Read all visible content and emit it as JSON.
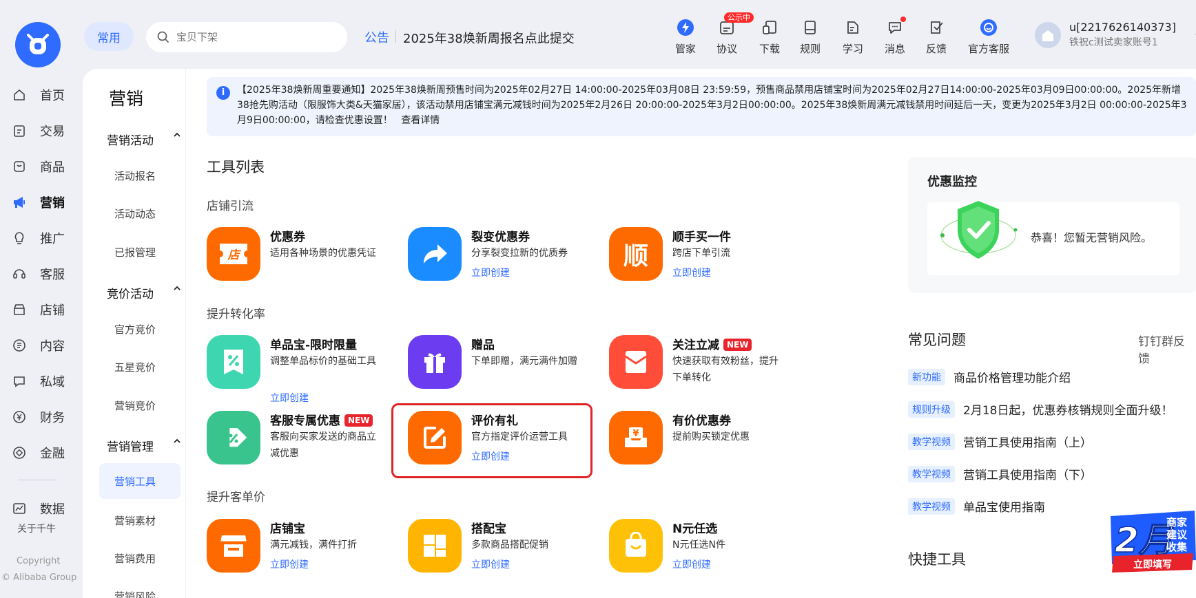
{
  "topbar": {
    "chip_label": "常用",
    "search_placeholder": "宝贝下架",
    "notice_tag": "公告",
    "notice_text": "2025年38焕新周报名点此提交",
    "tools": [
      {
        "label": "管家",
        "icon": "lightning-icon"
      },
      {
        "label": "协议",
        "icon": "agreement-icon",
        "badge": "公示中"
      },
      {
        "label": "下载",
        "icon": "download-icon"
      },
      {
        "label": "规则",
        "icon": "rules-icon"
      },
      {
        "label": "学习",
        "icon": "learn-icon"
      },
      {
        "label": "消息",
        "icon": "message-icon"
      },
      {
        "label": "反馈",
        "icon": "feedback-icon"
      },
      {
        "label": "官方客服",
        "icon": "customer-service-icon"
      }
    ],
    "user_id": "u[2217626140373]",
    "user_shop": "铁祝c测试卖家账号1"
  },
  "leftnav": {
    "items": [
      {
        "label": "首页",
        "icon": "home-icon"
      },
      {
        "label": "交易",
        "icon": "trade-icon"
      },
      {
        "label": "商品",
        "icon": "goods-icon"
      },
      {
        "label": "营销",
        "icon": "megaphone-icon"
      },
      {
        "label": "推广",
        "icon": "bulb-icon"
      },
      {
        "label": "客服",
        "icon": "headset-icon"
      },
      {
        "label": "店铺",
        "icon": "store-icon"
      },
      {
        "label": "内容",
        "icon": "content-icon"
      },
      {
        "label": "私域",
        "icon": "private-icon"
      },
      {
        "label": "财务",
        "icon": "finance-icon"
      },
      {
        "label": "金融",
        "icon": "bank-icon"
      },
      {
        "label": "数据",
        "icon": "data-icon"
      }
    ],
    "about": "关于千牛",
    "copyright_1": "Copyright",
    "copyright_2": "© Alibaba Group"
  },
  "subnav": {
    "title": "营销",
    "groups": [
      {
        "label": "营销活动",
        "items": [
          "活动报名",
          "活动动态",
          "已报管理"
        ]
      },
      {
        "label": "竞价活动",
        "items": [
          "官方竞价",
          "五星竞价",
          "营销竞价"
        ]
      },
      {
        "label": "营销管理",
        "items": [
          "营销工具",
          "营销素材",
          "营销费用",
          "营销风险"
        ]
      }
    ]
  },
  "announcement": "【2025年38焕新周重要通知】2025年38焕新周预售时间为2025年02月27日 14:00:00-2025年03月08日 23:59:59，预售商品禁用店铺宝时间为2025年02月27日14:00:00-2025年03月09日00:00:00。2025年新增38抢先购活动（限服饰大类&天猫家居），该活动禁用店铺宝满元减钱时间为2025年2月26日 20:00:00-2025年3月2日00:00:00。2025年38焕新周满元减钱禁用时间延后一天，变更为2025年3月2日 00:00:00-2025年3月9日00:00:00，请检查优惠设置！",
  "announcement_link": "查看详情",
  "tool_list": {
    "title": "工具列表",
    "categories": [
      "店铺引流",
      "提升转化率",
      "提升客单价"
    ],
    "link_label": "立即创建",
    "new_label": "NEW",
    "tools": [
      {
        "name": "优惠券",
        "desc": "适用各种场景的优惠凭证",
        "icon": "coupon-store-icon",
        "icon_text": "店"
      },
      {
        "name": "裂变优惠券",
        "desc": "分享裂变拉新的优质券",
        "icon": "share-arrow-icon"
      },
      {
        "name": "顺手买一件",
        "desc": "跨店下单引流",
        "icon": "shun-icon",
        "icon_text": "顺"
      },
      {
        "name": "单品宝-限时限量",
        "desc": "调整单品标价的基础工具",
        "icon": "percent-ticket-icon"
      },
      {
        "name": "赠品",
        "desc": "下单即赠，满元满件加赠",
        "icon": "gift-icon"
      },
      {
        "name": "关注立减",
        "desc": "快速获取有效粉丝，提升下单转化",
        "icon": "red-envelope-icon"
      },
      {
        "name": "客服专属优惠",
        "desc": "客服向买家发送的商品立减优惠",
        "icon": "tag-percent-icon"
      },
      {
        "name": "评价有礼",
        "desc": "官方指定评价运营工具",
        "icon": "edit-review-icon"
      },
      {
        "name": "有价优惠券",
        "desc": "提前购买锁定优惠",
        "icon": "yuan-box-icon",
        "icon_text": "¥"
      },
      {
        "name": "店铺宝",
        "desc": "满元减钱，满件打折",
        "icon": "shop-awning-icon"
      },
      {
        "name": "搭配宝",
        "desc": "多款商品搭配促销",
        "icon": "grid-layout-icon"
      },
      {
        "name": "N元任选",
        "desc": "N元任选N件",
        "icon": "shopping-bag-icon"
      }
    ]
  },
  "monitor": {
    "title": "优惠监控",
    "text": "恭喜！您暂无营销风险。"
  },
  "faq": {
    "title": "常见问题",
    "link": "钉钉群反馈",
    "items": [
      {
        "tag": "新功能",
        "text": "商品价格管理功能介绍"
      },
      {
        "tag": "规则升级",
        "text": "2月18日起，优惠券核销规则全面升级！"
      },
      {
        "tag": "教学视频",
        "text": "营销工具使用指南（上）"
      },
      {
        "tag": "教学视频",
        "text": "营销工具使用指南（下）"
      },
      {
        "tag": "教学视频",
        "text": "单品宝使用指南"
      }
    ]
  },
  "quick_tools_title": "快捷工具",
  "promo": {
    "big": "2月",
    "line1": "商家",
    "line2": "建议",
    "line3": "收集",
    "cta": "立即填写"
  },
  "colors": {
    "brand": "#2f6bff",
    "orange": "#ff6a00",
    "highlight": "#e02424"
  }
}
